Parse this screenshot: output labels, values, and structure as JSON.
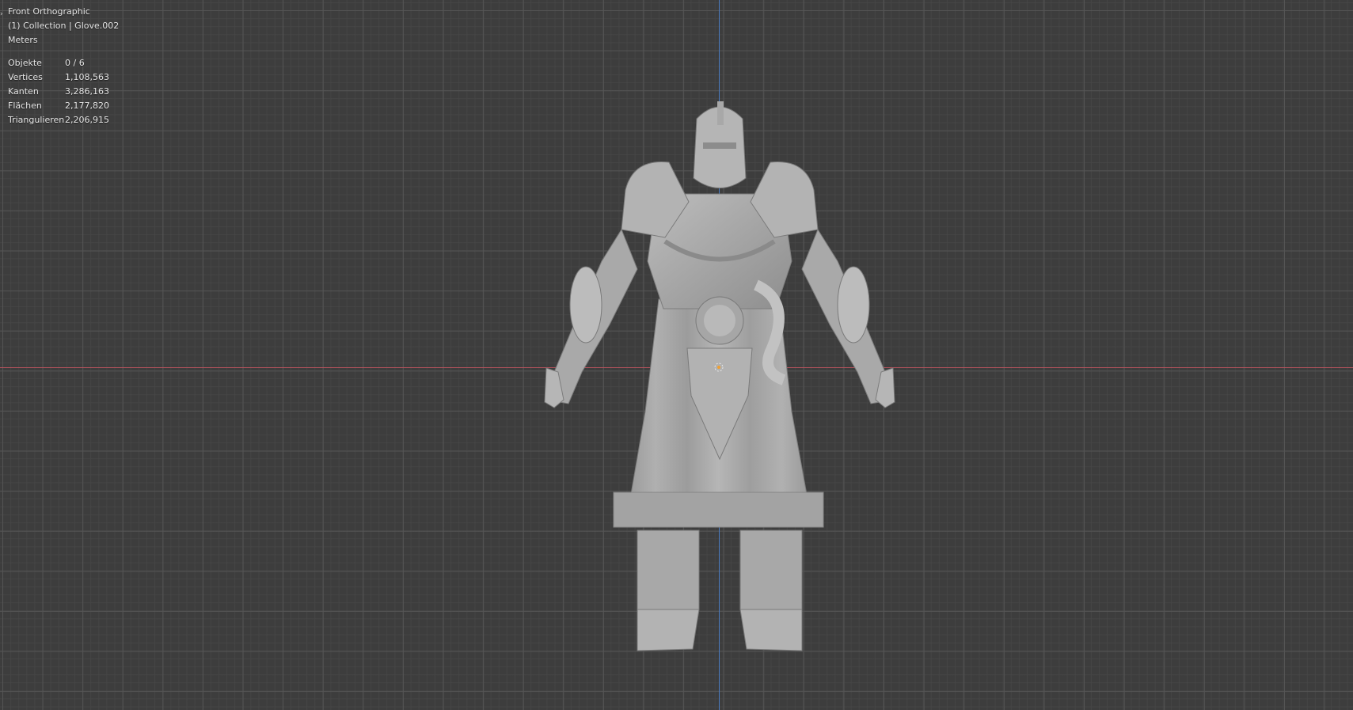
{
  "viewport": {
    "view_name": "Front Orthographic",
    "collection_line": "(1) Collection | Glove.002",
    "units": "Meters"
  },
  "stats": [
    {
      "label": "Objekte",
      "value": "0 / 6"
    },
    {
      "label": "Vertices",
      "value": "1,108,563"
    },
    {
      "label": "Kanten",
      "value": "3,286,163"
    },
    {
      "label": "Flächen",
      "value": "2,177,820"
    },
    {
      "label": "Triangulieren",
      "value": "2,206,915"
    }
  ],
  "colors": {
    "background": "#3d3d3d",
    "x_axis": "#b5535d",
    "z_axis": "#4a7bc0",
    "model": "#a7a7a7"
  },
  "icons": {
    "collapse": "chevron-right-icon",
    "origin": "3d-cursor-icon"
  }
}
